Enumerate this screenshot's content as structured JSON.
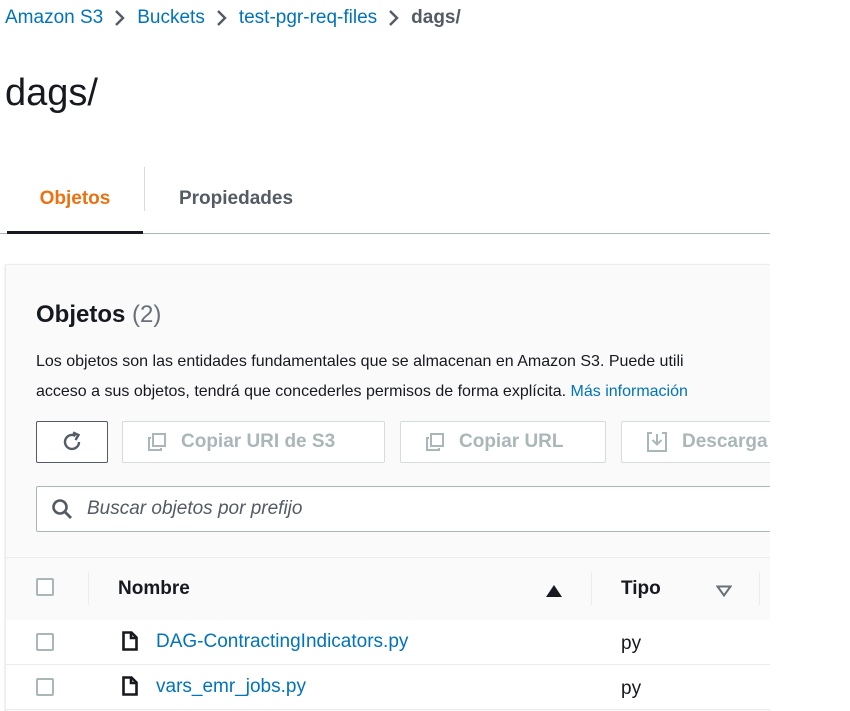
{
  "breadcrumb": {
    "items": [
      "Amazon S3",
      "Buckets",
      "test-pgr-req-files"
    ],
    "current": "dags/"
  },
  "page": {
    "title": "dags/"
  },
  "tabs": [
    {
      "label": "Objetos",
      "active": true
    },
    {
      "label": "Propiedades",
      "active": false
    }
  ],
  "objects_panel": {
    "title": "Objetos",
    "count": "(2)",
    "description_line1": "Los objetos son las entidades fundamentales que se almacenan en Amazon S3. Puede utili",
    "description_line2": "acceso a sus objetos, tendrá que concederles permisos de forma explícita.",
    "description_link": "Más información",
    "buttons": {
      "copy_uri": "Copiar URI de S3",
      "copy_url": "Copiar URL",
      "download": "Descarga"
    },
    "search": {
      "placeholder": "Buscar objetos por prefijo",
      "value": ""
    }
  },
  "table": {
    "columns": {
      "name": "Nombre",
      "type": "Tipo"
    },
    "rows": [
      {
        "name": "DAG-ContractingIndicators.py",
        "type": "py"
      },
      {
        "name": "vars_emr_jobs.py",
        "type": "py"
      }
    ]
  },
  "colors": {
    "link": "#0073bb",
    "active_tab": "#ec7211",
    "text": "#16191f",
    "disabled": "#aab7b8"
  },
  "icons": [
    "chevron-right-icon",
    "refresh-icon",
    "copy-icon",
    "download-icon",
    "search-icon",
    "sort-ascending-icon",
    "sort-descending-icon",
    "file-icon"
  ]
}
